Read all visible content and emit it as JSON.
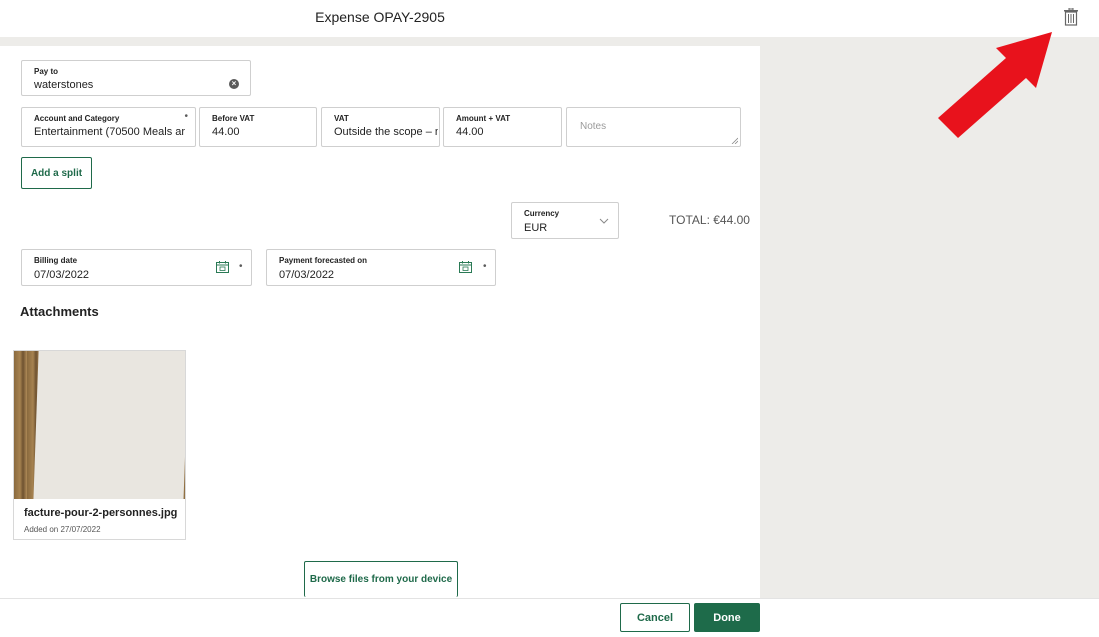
{
  "header": {
    "title": "Expense OPAY-2905",
    "delete_icon": "trash-icon"
  },
  "form": {
    "pay_to": {
      "label": "Pay to",
      "value": "waterstones"
    },
    "account": {
      "label": "Account and Category",
      "value": "Entertainment (70500 Meals ar"
    },
    "before_vat": {
      "label": "Before VAT",
      "value": "44.00"
    },
    "vat": {
      "label": "VAT",
      "value": "Outside the scope – n"
    },
    "amount_vat": {
      "label": "Amount + VAT",
      "value": "44.00"
    },
    "notes": {
      "placeholder": "Notes"
    },
    "add_split_label": "Add a split",
    "currency": {
      "label": "Currency",
      "value": "EUR"
    },
    "total": "TOTAL: €44.00",
    "billing_date": {
      "label": "Billing date",
      "value": "07/03/2022"
    },
    "payment_forecast": {
      "label": "Payment forecasted on",
      "value": "07/03/2022"
    }
  },
  "attachments": {
    "title": "Attachments",
    "items": [
      {
        "filename": "facture-pour-2-personnes.jpg",
        "added": "Added on 27/07/2022"
      }
    ],
    "browse_label": "Browse files from your device"
  },
  "footer": {
    "cancel_label": "Cancel",
    "done_label": "Done"
  },
  "colors": {
    "accent": "#1e6b4a",
    "arrow": "#e8121c",
    "background": "#edece9"
  }
}
